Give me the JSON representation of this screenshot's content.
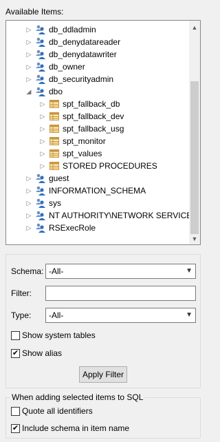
{
  "available_items_label": "Available Items:",
  "tree": {
    "rows": [
      {
        "label": "db_ddladmin",
        "level": 0,
        "icon": "user-role-icon",
        "expander": "collapsed"
      },
      {
        "label": "db_denydatareader",
        "level": 0,
        "icon": "user-role-icon",
        "expander": "collapsed"
      },
      {
        "label": "db_denydatawriter",
        "level": 0,
        "icon": "user-role-icon",
        "expander": "collapsed"
      },
      {
        "label": "db_owner",
        "level": 0,
        "icon": "user-role-icon",
        "expander": "collapsed"
      },
      {
        "label": "db_securityadmin",
        "level": 0,
        "icon": "user-role-icon",
        "expander": "collapsed"
      },
      {
        "label": "dbo",
        "level": 0,
        "icon": "user-role-icon",
        "expander": "expanded"
      },
      {
        "label": "spt_fallback_db",
        "level": 1,
        "icon": "table-icon",
        "expander": "collapsed"
      },
      {
        "label": "spt_fallback_dev",
        "level": 1,
        "icon": "table-icon",
        "expander": "collapsed"
      },
      {
        "label": "spt_fallback_usg",
        "level": 1,
        "icon": "table-icon",
        "expander": "collapsed"
      },
      {
        "label": "spt_monitor",
        "level": 1,
        "icon": "table-icon",
        "expander": "collapsed"
      },
      {
        "label": "spt_values",
        "level": 1,
        "icon": "table-icon",
        "expander": "collapsed"
      },
      {
        "label": "STORED PROCEDURES",
        "level": 1,
        "icon": "table-icon",
        "expander": "collapsed"
      },
      {
        "label": "guest",
        "level": 0,
        "icon": "user-role-icon",
        "expander": "collapsed"
      },
      {
        "label": "INFORMATION_SCHEMA",
        "level": 0,
        "icon": "user-role-icon",
        "expander": "collapsed"
      },
      {
        "label": "sys",
        "level": 0,
        "icon": "user-role-icon",
        "expander": "collapsed"
      },
      {
        "label": "NT AUTHORITY\\NETWORK SERVICE",
        "level": 0,
        "icon": "user-role-icon",
        "expander": "collapsed"
      },
      {
        "label": "RSExecRole",
        "level": 0,
        "icon": "user-role-icon",
        "expander": "collapsed"
      }
    ]
  },
  "filters": {
    "schema_label": "Schema:",
    "schema_value": "-All-",
    "filter_label": "Filter:",
    "filter_value": "",
    "type_label": "Type:",
    "type_value": "-All-",
    "show_system_tables_label": "Show system tables",
    "show_system_tables_checked": false,
    "show_alias_label": "Show alias",
    "show_alias_checked": true,
    "apply_filter_label": "Apply Filter"
  },
  "sql_options": {
    "group_title": "When adding selected items to SQL",
    "quote_all_label": "Quote all identifiers",
    "quote_all_checked": false,
    "include_schema_label": "Include schema in item name",
    "include_schema_checked": true
  },
  "colors": {
    "table_icon_border": "#c8963c",
    "table_icon_fill": "#fbe7b5",
    "user_icon_blue": "#2f6fc0",
    "tree_border": "#828790"
  }
}
